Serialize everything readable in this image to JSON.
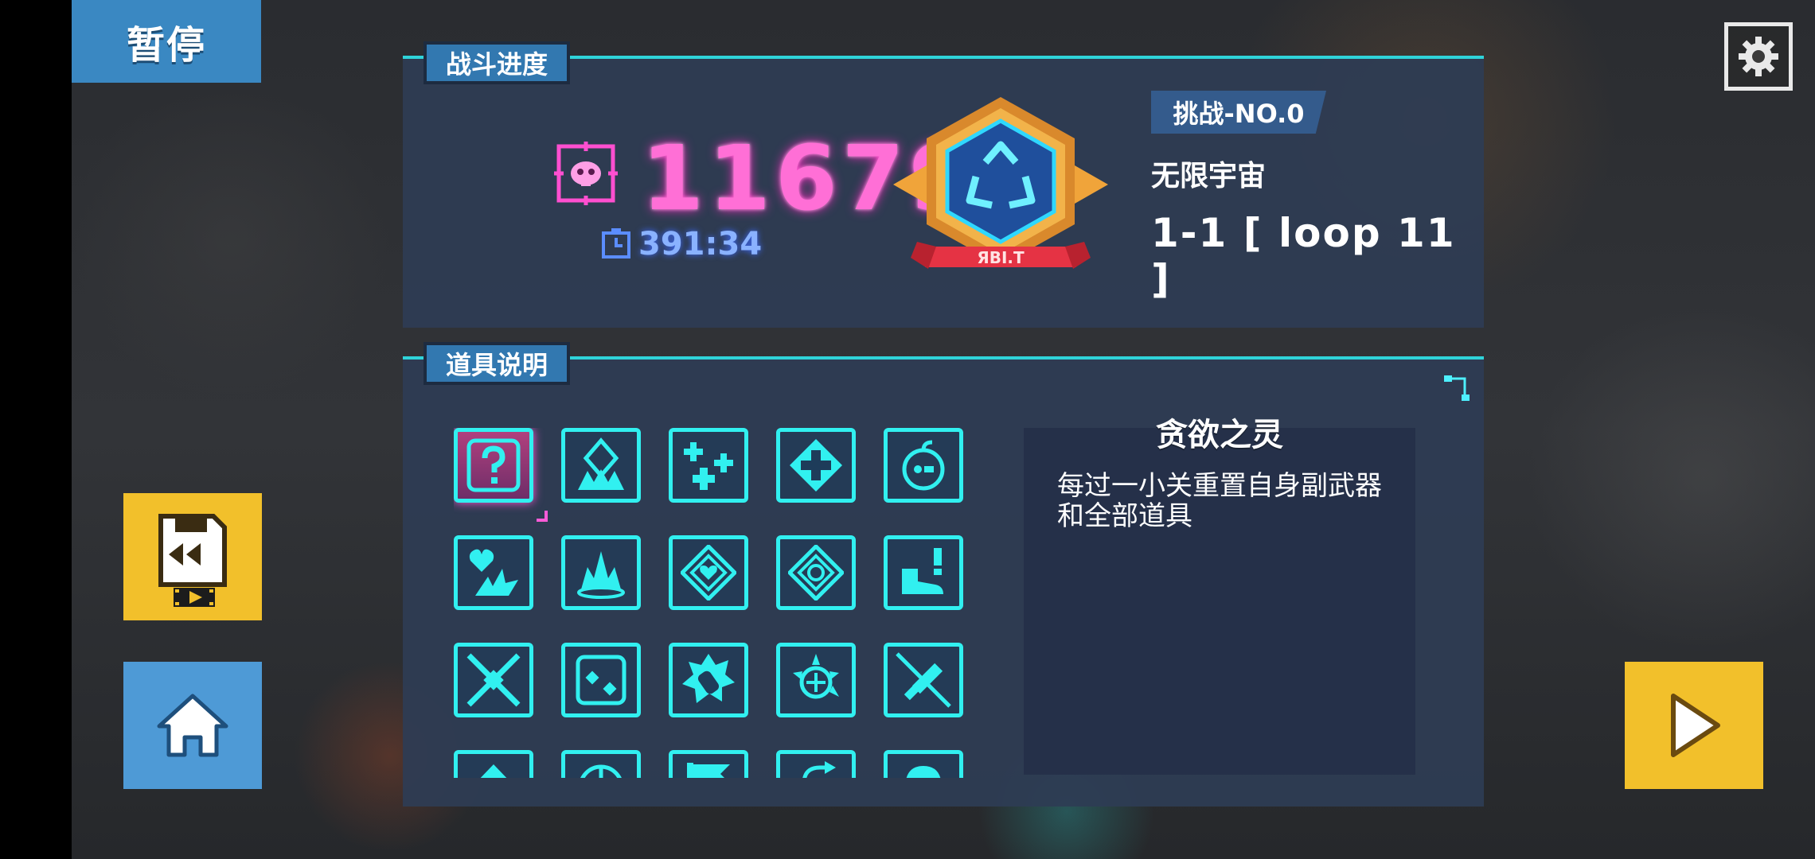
{
  "header": {
    "pause_label": "暂停"
  },
  "battle_progress": {
    "tab_label": "战斗进度",
    "kill_count": "11679",
    "timer": "391:34",
    "badge_banner_text": "ЯBI.T",
    "challenge_tag": "挑战-NO.0",
    "mode_name": "无限宇宙",
    "stage_label": "1-1 [ loop 11 ]"
  },
  "item_description": {
    "tab_label": "道具说明",
    "selected_item_name": "贪欲之灵",
    "selected_item_desc": "每过一小关重置自身副武器和全部道具",
    "items": [
      {
        "icon": "question-mark-icon",
        "selected": true
      },
      {
        "icon": "diamond-burst-icon"
      },
      {
        "icon": "triple-cross-icon"
      },
      {
        "icon": "medic-cross-icon"
      },
      {
        "icon": "bomb-face-icon"
      },
      {
        "icon": "heart-burst-icon"
      },
      {
        "icon": "fire-burst-icon"
      },
      {
        "icon": "heart-diamond-icon"
      },
      {
        "icon": "target-diamond-icon"
      },
      {
        "icon": "boot-alert-icon"
      },
      {
        "icon": "crossed-swords-icon"
      },
      {
        "icon": "dice-icon"
      },
      {
        "icon": "shell-burst-icon"
      },
      {
        "icon": "spiky-target-icon"
      },
      {
        "icon": "sword-slash-icon"
      },
      {
        "icon": "arrow-up-icon"
      },
      {
        "icon": "half-circle-icon"
      },
      {
        "icon": "flag-icon"
      },
      {
        "icon": "loop-arrow-icon"
      },
      {
        "icon": "dome-icon"
      }
    ]
  },
  "colors": {
    "accent_cyan": "#31f0f0",
    "kill_pink": "#ff6fd6",
    "pause_blue": "#3a88c2",
    "button_yellow": "#f2c02b",
    "home_blue": "#4e9ad6"
  }
}
